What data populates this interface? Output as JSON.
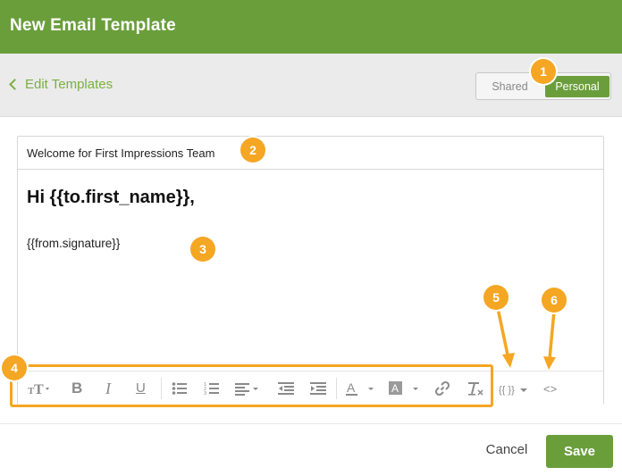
{
  "window": {
    "title": "New Email Template"
  },
  "nav": {
    "back_label": "Edit Templates"
  },
  "visibility_toggle": {
    "shared_label": "Shared",
    "personal_label": "Personal",
    "selected": "Personal"
  },
  "template": {
    "subject": "Welcome for First Impressions Team",
    "greeting": "Hi {{to.first_name}},",
    "signature": "{{from.signature}}"
  },
  "toolbar": {
    "font_size_icon": "text-size-icon",
    "bold_label": "B",
    "italic_label": "I",
    "underline_label": "U",
    "variables_label": "{{ }}",
    "code_view_label": "<>",
    "text_color_label": "A",
    "highlight_label": "A"
  },
  "annotations": {
    "badges": [
      "1",
      "2",
      "3",
      "4",
      "5",
      "6"
    ]
  },
  "footer": {
    "cancel_label": "Cancel",
    "save_label": "Save"
  },
  "colors": {
    "brand_green": "#6a9e3b",
    "link_green": "#7bb040",
    "annotation_orange": "#f5a623"
  }
}
